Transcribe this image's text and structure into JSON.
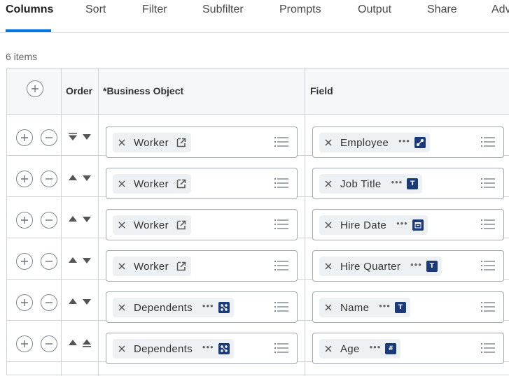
{
  "tabs": [
    {
      "label": "Columns",
      "active": true
    },
    {
      "label": "Sort"
    },
    {
      "label": "Filter"
    },
    {
      "label": "Subfilter"
    },
    {
      "label": "Prompts"
    },
    {
      "label": "Output"
    },
    {
      "label": "Share"
    },
    {
      "label": "Adv"
    }
  ],
  "items_count": "6 items",
  "grid": {
    "headers": {
      "order": "Order",
      "business_object": "*Business Object",
      "field": "Field"
    },
    "rows": [
      {
        "business_object": "Worker",
        "bo_icon": "external-link-icon",
        "field": "Employee",
        "field_type": "instance-icon",
        "field_type_text": "",
        "sort_up": "top-icon",
        "sort_down": "down-arrow-icon"
      },
      {
        "business_object": "Worker",
        "bo_icon": "external-link-icon",
        "field": "Job Title",
        "field_type": "text-type-icon",
        "field_type_text": "T",
        "sort_up": "up-arrow-icon",
        "sort_down": "down-arrow-icon"
      },
      {
        "business_object": "Worker",
        "bo_icon": "external-link-icon",
        "field": "Hire Date",
        "field_type": "date-type-icon",
        "field_type_text": "",
        "sort_up": "up-arrow-icon",
        "sort_down": "down-arrow-icon"
      },
      {
        "business_object": "Worker",
        "bo_icon": "external-link-icon",
        "field": "Hire Quarter",
        "field_type": "text-type-icon",
        "field_type_text": "T",
        "sort_up": "up-arrow-icon",
        "sort_down": "down-arrow-icon"
      },
      {
        "business_object": "Dependents",
        "bo_icon": "related-objects-icon",
        "field": "Name",
        "field_type": "text-type-icon",
        "field_type_text": "T",
        "sort_up": "up-arrow-icon",
        "sort_down": "down-arrow-icon"
      },
      {
        "business_object": "Dependents",
        "bo_icon": "related-objects-icon",
        "field": "Age",
        "field_type": "numeric-type-icon",
        "field_type_text": "#",
        "sort_up": "up-arrow-icon",
        "sort_down": "bottom-icon"
      }
    ]
  },
  "colors": {
    "accent": "#0875e1",
    "type_icon": "#1a3a7a",
    "border": "#ced3d9"
  }
}
